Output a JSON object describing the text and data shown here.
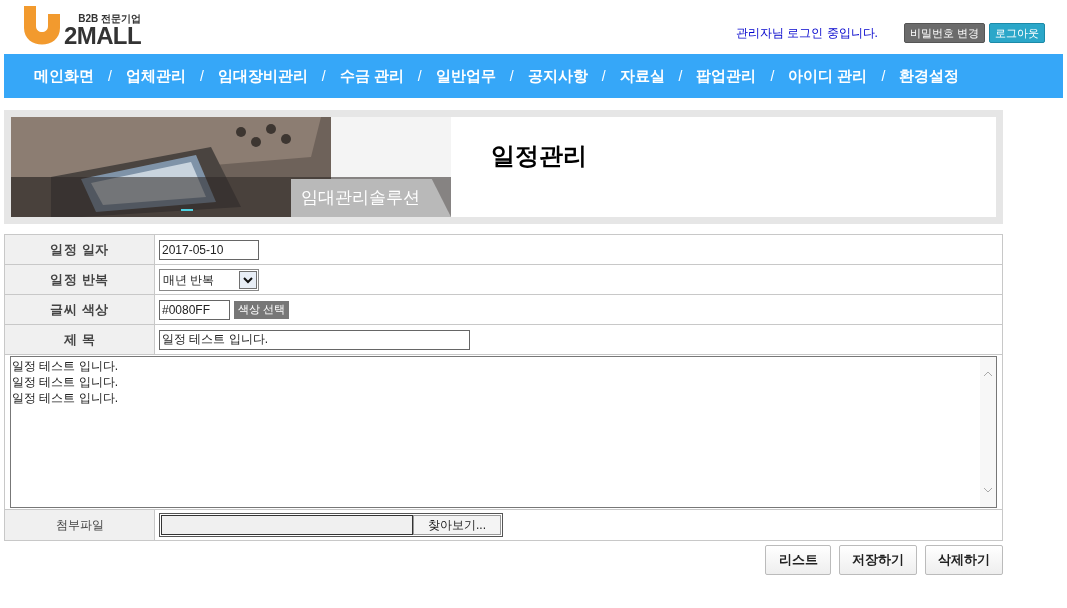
{
  "logo": {
    "tagline": "B2B 전문기업",
    "wordmark": "2MALL"
  },
  "header": {
    "login_status": "관리자님 로그인 중입니다.",
    "buttons": [
      {
        "label": "비밀번호 변경",
        "kind": "gray"
      },
      {
        "label": "로그아웃",
        "kind": "teal"
      }
    ]
  },
  "nav": [
    {
      "kind": "link",
      "label": "메인화면"
    },
    {
      "kind": "separator",
      "label": "/"
    },
    {
      "kind": "link",
      "label": "업체관리"
    },
    {
      "kind": "separator",
      "label": "/"
    },
    {
      "kind": "link",
      "label": "임대장비관리"
    },
    {
      "kind": "separator",
      "label": "/"
    },
    {
      "kind": "link",
      "label": "수금 관리"
    },
    {
      "kind": "separator",
      "label": "/"
    },
    {
      "kind": "link",
      "label": "일반업무"
    },
    {
      "kind": "separator",
      "label": "/"
    },
    {
      "kind": "link",
      "label": "공지사항"
    },
    {
      "kind": "separator",
      "label": "/"
    },
    {
      "kind": "link",
      "label": "자료실"
    },
    {
      "kind": "separator",
      "label": "/"
    },
    {
      "kind": "link",
      "label": "팝업관리"
    },
    {
      "kind": "separator",
      "label": "/"
    },
    {
      "kind": "link",
      "label": "아이디 관리"
    },
    {
      "kind": "separator",
      "label": "/"
    },
    {
      "kind": "link",
      "label": "환경설정"
    }
  ],
  "banner": {
    "tab_label": "임대관리솔루션",
    "title": "일정관리"
  },
  "form": [
    {
      "kind": "text",
      "label": "일정 일자",
      "value": "2017-05-10"
    },
    {
      "kind": "select",
      "label": "일정 반복",
      "value": "매년 반복"
    },
    {
      "kind": "color",
      "label": "글씨 색상",
      "value": "#0080FF",
      "button": "색상 선택"
    },
    {
      "kind": "title",
      "label": "제 목",
      "value": "일정 테스트 입니다."
    }
  ],
  "body_lines": [
    "일정 테스트 입니다.",
    "일정 테스트 입니다.",
    "일정 테스트 입니다."
  ],
  "attachment": {
    "label": "첨부파일",
    "button": "찾아보기..."
  },
  "actions": [
    "리스트",
    "저장하기",
    "삭제하기"
  ]
}
